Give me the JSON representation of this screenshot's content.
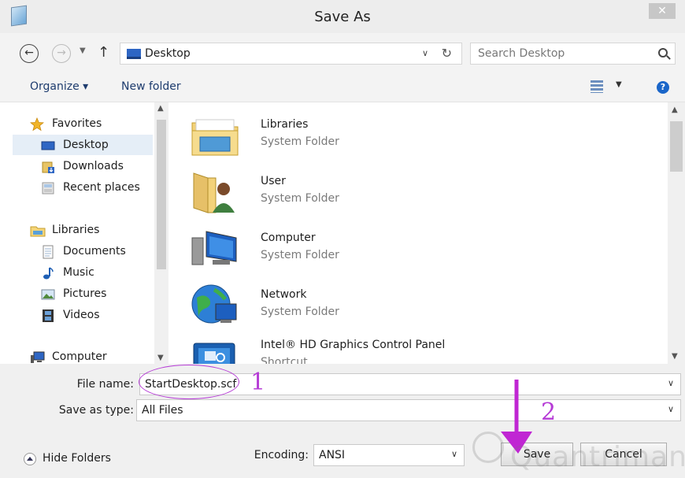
{
  "window": {
    "title": "Save As",
    "close_symbol": "✕"
  },
  "address": {
    "path": "Desktop",
    "search_placeholder": "Search Desktop"
  },
  "toolbar": {
    "organize": "Organize ▾",
    "new_folder": "New folder",
    "help": "?"
  },
  "nav": {
    "favorites": "Favorites",
    "desktop": "Desktop",
    "downloads": "Downloads",
    "recent_places": "Recent places",
    "libraries": "Libraries",
    "documents": "Documents",
    "music": "Music",
    "pictures": "Pictures",
    "videos": "Videos",
    "computer": "Computer"
  },
  "files": [
    {
      "name": "Libraries",
      "type": "System Folder",
      "icon": "libraries-icon"
    },
    {
      "name": "User",
      "type": "System Folder",
      "icon": "user-folder-icon"
    },
    {
      "name": "Computer",
      "type": "System Folder",
      "icon": "computer-icon"
    },
    {
      "name": "Network",
      "type": "System Folder",
      "icon": "network-icon"
    },
    {
      "name": "Intel® HD Graphics Control Panel",
      "type": "Shortcut",
      "icon": "intel-graphics-icon"
    }
  ],
  "form": {
    "file_name_label": "File name:",
    "file_name_value": "StartDesktop.scf",
    "save_type_label": "Save as type:",
    "save_type_value": "All Files",
    "encoding_label": "Encoding:",
    "encoding_value": "ANSI"
  },
  "buttons": {
    "hide_folders": "Hide Folders",
    "save": "Save",
    "cancel": "Cancel"
  },
  "annotations": {
    "step1": "1",
    "step2": "2",
    "color": "#b63cd6"
  }
}
